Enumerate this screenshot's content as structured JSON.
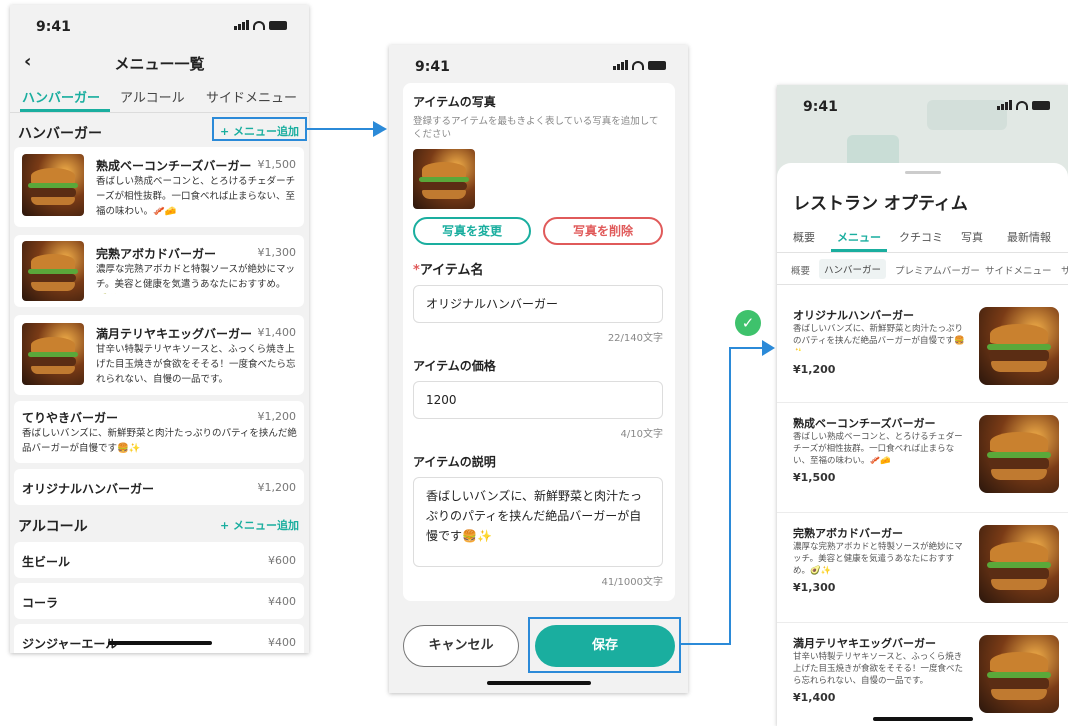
{
  "status_time": "9:41",
  "screen1": {
    "title": "メニュー一覧",
    "tabs": [
      "ハンバーガー",
      "アルコール",
      "サイドメニュー"
    ],
    "section_burger": "ハンバーガー",
    "add_label": "+ メニュー追加",
    "items": [
      {
        "name": "熟成ベーコンチーズバーガー",
        "price": "¥1,500",
        "desc": "香ばしい熟成ベーコンと、とろけるチェダーチーズが相性抜群。一口食べれば止まらない、至福の味わい。🥓🧀"
      },
      {
        "name": "完熟アボカドバーガー",
        "price": "¥1,300",
        "desc": "濃厚な完熟アボカドと特製ソースが絶妙にマッチ。美容と健康を気遣うあなたにおすすめ。🥑✨"
      },
      {
        "name": "満月テリヤキエッグバーガー",
        "price": "¥1,400",
        "desc": "甘辛い特製テリヤキソースと、ふっくら焼き上げた目玉焼きが食欲をそそる！一度食べたら忘れられない、自慢の一品です。"
      }
    ],
    "teriyaki": {
      "name": "てりやきバーガー",
      "price": "¥1,200",
      "desc": "香ばしいバンズに、新鮮野菜と肉汁たっぷりのパティを挟んだ絶品バーガーが自慢です🍔✨"
    },
    "original": {
      "name": "オリジナルハンバーガー",
      "price": "¥1,200"
    },
    "section_alcohol": "アルコール",
    "alcohol": [
      {
        "name": "生ビール",
        "price": "¥600"
      },
      {
        "name": "コーラ",
        "price": "¥400"
      },
      {
        "name": "ジンジャーエール",
        "price": "¥400"
      }
    ]
  },
  "screen2": {
    "photo_title": "アイテムの写真",
    "photo_hint": "登録するアイテムを最もきよく表している写真を追加してください",
    "change_photo": "写真を変更",
    "delete_photo": "写真を削除",
    "required_mark": "*",
    "name_label": "アイテム名",
    "name_value": "オリジナルハンバーガー",
    "name_count": "22/140文字",
    "price_label": "アイテムの価格",
    "price_value": "1200",
    "price_count": "4/10文字",
    "desc_label": "アイテムの説明",
    "desc_value": "香ばしいバンズに、新鮮野菜と肉汁たっぷりのパティを挟んだ絶品バーガーが自慢です🍔✨",
    "desc_count": "41/1000文字",
    "cancel": "キャンセル",
    "save": "保存"
  },
  "screen3": {
    "restaurant": "レストラン オプティム",
    "tabs": [
      "概要",
      "メニュー",
      "クチコミ",
      "写真",
      "最新情報"
    ],
    "chips": [
      "概要",
      "ハンバーガー",
      "プレミアムバーガー",
      "サイドメニュー",
      "サ"
    ],
    "items": [
      {
        "name": "オリジナルハンバーガー",
        "desc": "香ばしいバンズに、新鮮野菜と肉汁たっぷりのパティを挟んだ絶品バーガーが自慢です🍔✨",
        "price": "¥1,200"
      },
      {
        "name": "熟成ベーコンチーズバーガー",
        "desc": "香ばしい熟成ベーコンと、とろけるチェダーチーズが相性抜群。一口食べれば止まらない、至福の味わい。🥓🧀",
        "price": "¥1,500"
      },
      {
        "name": "完熟アボカドバーガー",
        "desc": "濃厚な完熟アボカドと特製ソースが絶妙にマッチ。美容と健康を気遣うあなたにおすすめ。🥑✨",
        "price": "¥1,300"
      },
      {
        "name": "満月テリヤキエッグバーガー",
        "desc": "甘辛い特製テリヤキソースと、ふっくら焼き上げた目玉焼きが食欲をそそる！一度食べたら忘れられない、自慢の一品です。",
        "price": "¥1,400"
      }
    ]
  },
  "colors": {
    "accent": "#1aae9f",
    "danger": "#e05a5a",
    "flow": "#2b8ad8",
    "success": "#3ec26c"
  }
}
